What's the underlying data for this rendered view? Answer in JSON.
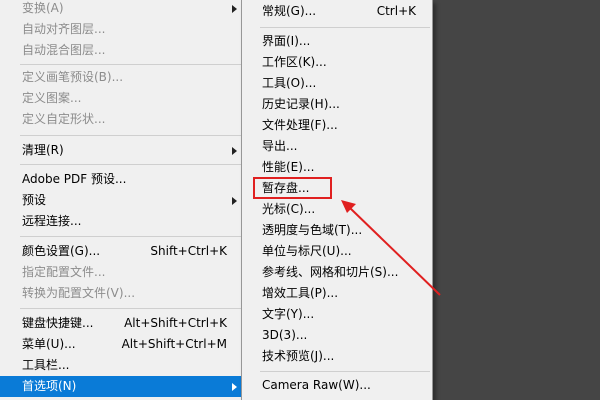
{
  "edit_menu": {
    "items": [
      {
        "label": "变换(A)",
        "shortcut": "",
        "disabled": true,
        "submenu": true
      },
      {
        "label": "自动对齐图层...",
        "shortcut": "",
        "disabled": true,
        "submenu": false
      },
      {
        "label": "自动混合图层...",
        "shortcut": "",
        "disabled": true,
        "submenu": false
      },
      {
        "label": "定义画笔预设(B)...",
        "shortcut": "",
        "disabled": true,
        "submenu": false
      },
      {
        "label": "定义图案...",
        "shortcut": "",
        "disabled": true,
        "submenu": false
      },
      {
        "label": "定义自定形状...",
        "shortcut": "",
        "disabled": true,
        "submenu": false
      },
      {
        "label": "清理(R)",
        "shortcut": "",
        "disabled": false,
        "submenu": true
      },
      {
        "label": "Adobe PDF 预设...",
        "shortcut": "",
        "disabled": false,
        "submenu": false
      },
      {
        "label": "预设",
        "shortcut": "",
        "disabled": false,
        "submenu": true
      },
      {
        "label": "远程连接...",
        "shortcut": "",
        "disabled": false,
        "submenu": false
      },
      {
        "label": "颜色设置(G)...",
        "shortcut": "Shift+Ctrl+K",
        "disabled": false,
        "submenu": false
      },
      {
        "label": "指定配置文件...",
        "shortcut": "",
        "disabled": true,
        "submenu": false
      },
      {
        "label": "转换为配置文件(V)...",
        "shortcut": "",
        "disabled": true,
        "submenu": false
      },
      {
        "label": "键盘快捷键...",
        "shortcut": "Alt+Shift+Ctrl+K",
        "disabled": false,
        "submenu": false
      },
      {
        "label": "菜单(U)...",
        "shortcut": "Alt+Shift+Ctrl+M",
        "disabled": false,
        "submenu": false
      },
      {
        "label": "工具栏...",
        "shortcut": "",
        "disabled": false,
        "submenu": false
      },
      {
        "label": "首选项(N)",
        "shortcut": "",
        "disabled": false,
        "submenu": true,
        "highlighted": true
      }
    ]
  },
  "preferences_menu": {
    "items": [
      {
        "label": "常规(G)...",
        "shortcut": "Ctrl+K"
      },
      {
        "label": "界面(I)...",
        "shortcut": ""
      },
      {
        "label": "工作区(K)...",
        "shortcut": ""
      },
      {
        "label": "工具(O)...",
        "shortcut": ""
      },
      {
        "label": "历史记录(H)...",
        "shortcut": ""
      },
      {
        "label": "文件处理(F)...",
        "shortcut": ""
      },
      {
        "label": "导出...",
        "shortcut": ""
      },
      {
        "label": "性能(E)...",
        "shortcut": ""
      },
      {
        "label": "暂存盘...",
        "shortcut": ""
      },
      {
        "label": "光标(C)...",
        "shortcut": ""
      },
      {
        "label": "透明度与色域(T)...",
        "shortcut": ""
      },
      {
        "label": "单位与标尺(U)...",
        "shortcut": ""
      },
      {
        "label": "参考线、网格和切片(S)...",
        "shortcut": ""
      },
      {
        "label": "增效工具(P)...",
        "shortcut": ""
      },
      {
        "label": "文字(Y)...",
        "shortcut": ""
      },
      {
        "label": "3D(3)...",
        "shortcut": ""
      },
      {
        "label": "技术预览(J)...",
        "shortcut": ""
      },
      {
        "label": "Camera Raw(W)...",
        "shortcut": ""
      }
    ]
  },
  "colors": {
    "menu_background": "#f0f0f0",
    "highlight": "#0a7bd7",
    "annotation": "#e02020",
    "app_background": "#454545"
  },
  "icons": [
    "submenu-arrow-icon",
    "annotation-arrow-icon"
  ]
}
